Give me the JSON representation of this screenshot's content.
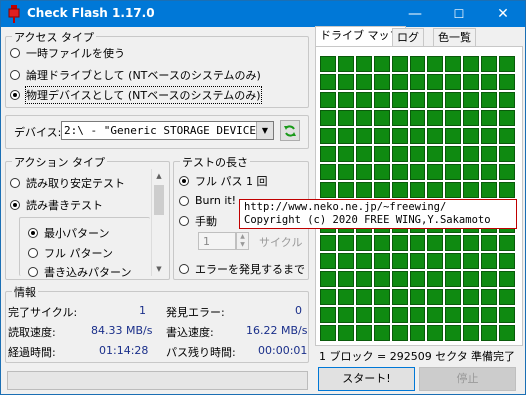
{
  "window": {
    "title": "Check Flash 1.17.0",
    "minimize": "—",
    "maximize": "☐",
    "close": "✕"
  },
  "access": {
    "title": "アクセス タイプ",
    "options": [
      {
        "label": "一時ファイルを使う",
        "checked": false
      },
      {
        "label": "論理ドライブとして (NTベースのシステムのみ)",
        "checked": false
      },
      {
        "label": "物理デバイスとして (NTベースのシステムのみ)",
        "checked": true
      }
    ]
  },
  "device": {
    "label": "デバイス:",
    "value": "2:\\ - \"Generic STORAGE DEVICE",
    "refresh_icon": "refresh-icon"
  },
  "action": {
    "title": "アクション タイプ",
    "read_stability": "読み取り安定テスト",
    "read_write": "読み書きテスト",
    "patterns": [
      "最小パターン",
      "フル パターン",
      "書き込みパターン"
    ]
  },
  "length": {
    "title": "テストの長さ",
    "full_pass": "フル パス 1 回",
    "burn_in": "Burn it!",
    "manual": "手動",
    "cycles_value": "1",
    "cycles_label": "サイクル",
    "until_error": "エラーを発見するまで"
  },
  "info": {
    "title": "情報",
    "rows": [
      {
        "l1": "完了サイクル:",
        "v1": "1",
        "l2": "発見エラー:",
        "v2": "0"
      },
      {
        "l1": "読取速度:",
        "v1": "84.33 MB/s",
        "l2": "書込速度:",
        "v2": "16.22 MB/s"
      },
      {
        "l1": "経過時間:",
        "v1": "01:14:28",
        "l2": "パス残り時間:",
        "v2": "00:00:01"
      }
    ]
  },
  "tabs": [
    "ドライブ マップ",
    "ログ",
    "色一覧"
  ],
  "map": {
    "block_info": "1 ブロック = 292509 セクタ",
    "status": "準備完了",
    "cell_color": "#0f8a11"
  },
  "tooltip": {
    "line1": "http://www.neko.ne.jp/~freewing/",
    "line2": "Copyright (c) 2020 FREE WING,Y.Sakamoto"
  },
  "buttons": {
    "start": "スタート!",
    "stop": "停止"
  },
  "progress": 0
}
